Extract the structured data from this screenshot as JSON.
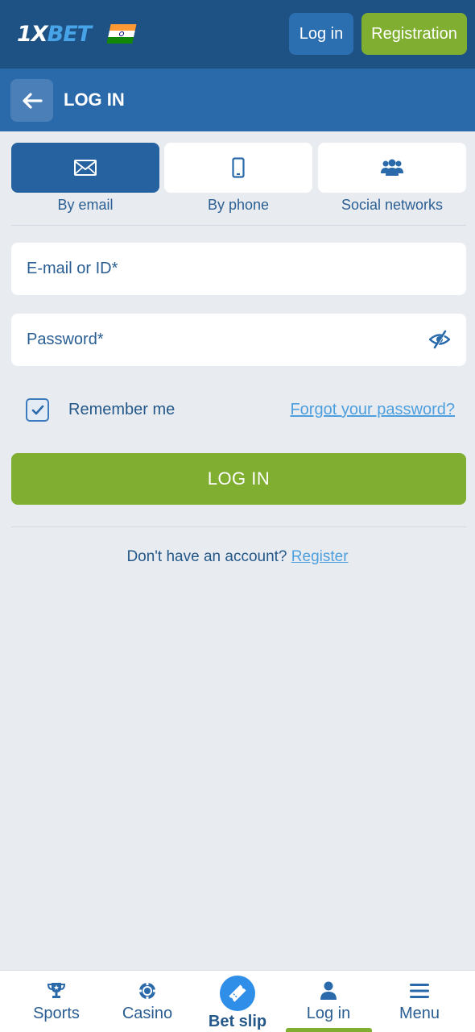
{
  "brand": {
    "logo_prefix": "1X",
    "logo_suffix": "BET"
  },
  "header": {
    "login_label": "Log in",
    "registration_label": "Registration"
  },
  "subheader": {
    "title": "LOG IN"
  },
  "tabs": [
    {
      "label": "By email",
      "icon": "envelope-icon",
      "active": true
    },
    {
      "label": "By phone",
      "icon": "phone-icon",
      "active": false
    },
    {
      "label": "Social networks",
      "icon": "users-icon",
      "active": false
    }
  ],
  "form": {
    "email": {
      "placeholder": "E-mail or ID*",
      "value": ""
    },
    "password": {
      "placeholder": "Password*",
      "value": ""
    },
    "remember_me": {
      "label": "Remember me",
      "checked": true
    },
    "forgot_label": "Forgot your password?",
    "submit_label": "LOG IN",
    "no_account_text": "Don't have an account?",
    "register_link": "Register"
  },
  "bottom_nav": [
    {
      "label": "Sports",
      "icon": "trophy-icon"
    },
    {
      "label": "Casino",
      "icon": "casino-chip-icon"
    },
    {
      "label": "Bet slip",
      "icon": "ticket-icon"
    },
    {
      "label": "Log in",
      "icon": "user-icon",
      "active": true
    },
    {
      "label": "Menu",
      "icon": "menu-icon"
    }
  ],
  "colors": {
    "topbar": "#1f5284",
    "subheader": "#2a6aaa",
    "accent_green": "#7fae30",
    "active_tab": "#2662a0",
    "link": "#4d9fde",
    "background": "#e8ecf1"
  }
}
